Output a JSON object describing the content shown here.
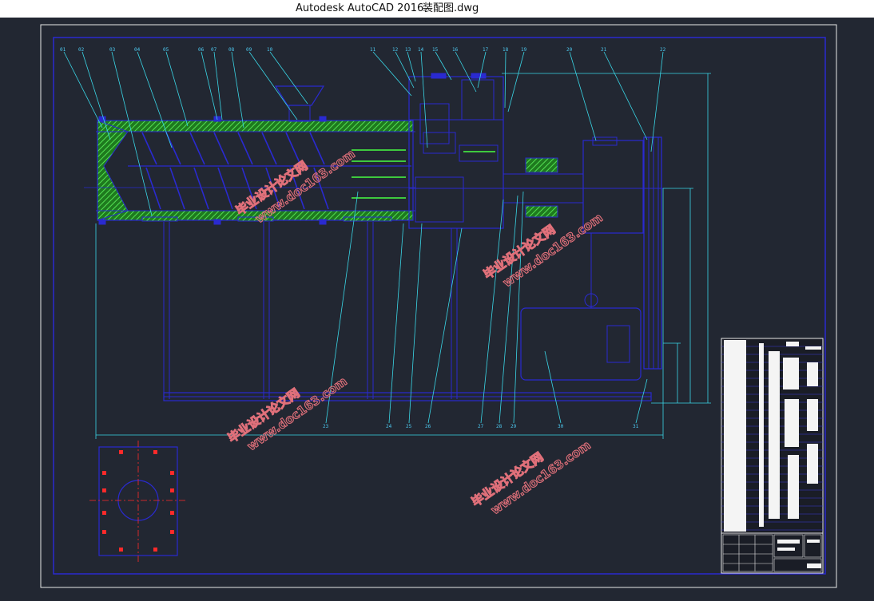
{
  "window": {
    "app_name": "Autodesk AutoCAD 2016",
    "file_name": "装配图.dwg"
  },
  "watermark": {
    "cn_text": "毕业设计论文网",
    "url_text": "www.doc163.com"
  },
  "colors": {
    "background": "#222732",
    "border_white": "#e8e8e8",
    "drawing_blue": "#2a2ad0",
    "leader_cyan": "#3ad6e6",
    "hatch_green": "#3ec93e",
    "center_red": "#ff2a2a",
    "table_white": "#f4f4f4",
    "watermark": "#e0707a"
  },
  "icons": [
    "drawing-border",
    "assembly-view",
    "flange-view",
    "title-block"
  ]
}
